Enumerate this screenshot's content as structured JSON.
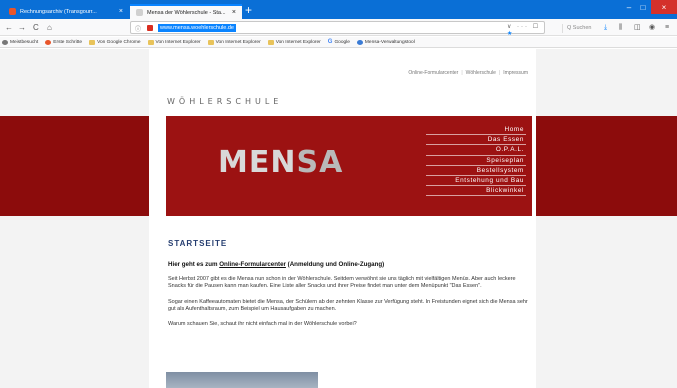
{
  "browser": {
    "tabs": [
      {
        "label": "Rechnungsarchiv (Transgourr...",
        "close": "×"
      },
      {
        "label": "Mensa der Wöhlerschule - Sta...",
        "close": "×"
      }
    ],
    "new_tab": "+",
    "window_controls": {
      "minimize": "–",
      "maximize": "□",
      "close": "×"
    },
    "nav": {
      "back": "←",
      "forward": "→",
      "reload": "C",
      "home": "⌂"
    },
    "url_info_icon": "ⓘ",
    "url": "www.mensa.woehlerschule.de",
    "url_actions": "∨ ··· ☐",
    "url_star": "★",
    "search_placeholder": "Q  Suchen",
    "toolbar_icons": [
      "download-icon",
      "library-icon",
      "sidebar-icon",
      "account-icon",
      "menu-icon"
    ],
    "toolbar_glyphs": [
      "⤓",
      "⫼",
      "◫",
      "◉",
      "≡"
    ],
    "bookmarks": [
      {
        "label": "Meistbesucht",
        "icon": "gear-icon"
      },
      {
        "label": "Erste Schritte",
        "icon": "firefox-icon"
      },
      {
        "label": "Von Google Chrome",
        "icon": "folder-icon"
      },
      {
        "label": "Von Internet Explorer",
        "icon": "folder-icon"
      },
      {
        "label": "Von Internet Explorer",
        "icon": "folder-icon"
      },
      {
        "label": "Von Internet Explorer",
        "icon": "folder-icon"
      },
      {
        "label": "Google",
        "icon": "google-icon"
      },
      {
        "label": "Mensa-Verwaltungstool",
        "icon": "globe-icon"
      }
    ]
  },
  "page": {
    "top_links": [
      "Online-Formularcenter",
      "Wöhlerschule",
      "Impressum"
    ],
    "top_links_separator": "|",
    "site_title": "WÖHLERSCHULE",
    "logo": {
      "part1": "MEN",
      "part2": "SA"
    },
    "nav_items": [
      "Home",
      "Das Essen",
      "O.P.A.L.",
      "Speiseplan",
      "Bestellsystem",
      "Entstehung und Bau",
      "Blickwinkel"
    ],
    "heading": "STARTSEITE",
    "lead": {
      "prefix": "Hier geht es zum ",
      "link": "Online-Formularcenter",
      "suffix": " (Anmeldung und Online-Zugang)"
    },
    "paragraphs": [
      "Seit Herbst 2007 gibt es die Mensa nun schon in der Wöhlerschule. Seitdem verwöhnt sie uns täglich mit vielfältigen Menüs. Aber auch leckere Snacks für die Pausen kann man kaufen. Eine Liste aller Snacks und ihrer Preise findet man unter dem Menüpunkt \"Das Essen\".",
      "Sogar einen Kaffeeautomaten bietet die Mensa, der Schülern ab der zehnten Klasse zur Verfügung steht. In Freistunden eignet sich die Mensa sehr gut als Aufenthaltsraum, zum Beispiel um Hausaufgaben zu machen.",
      "Warum schauen Sie, schaut ihr nicht einfach mal in der Wöhlerschule vorbei?"
    ]
  },
  "colors": {
    "tab_bar": "#0a6fd6",
    "header_band": "#8c0c0c",
    "header": "#9c1212",
    "heading": "#263e70",
    "url_highlight": "#0a84ff"
  }
}
